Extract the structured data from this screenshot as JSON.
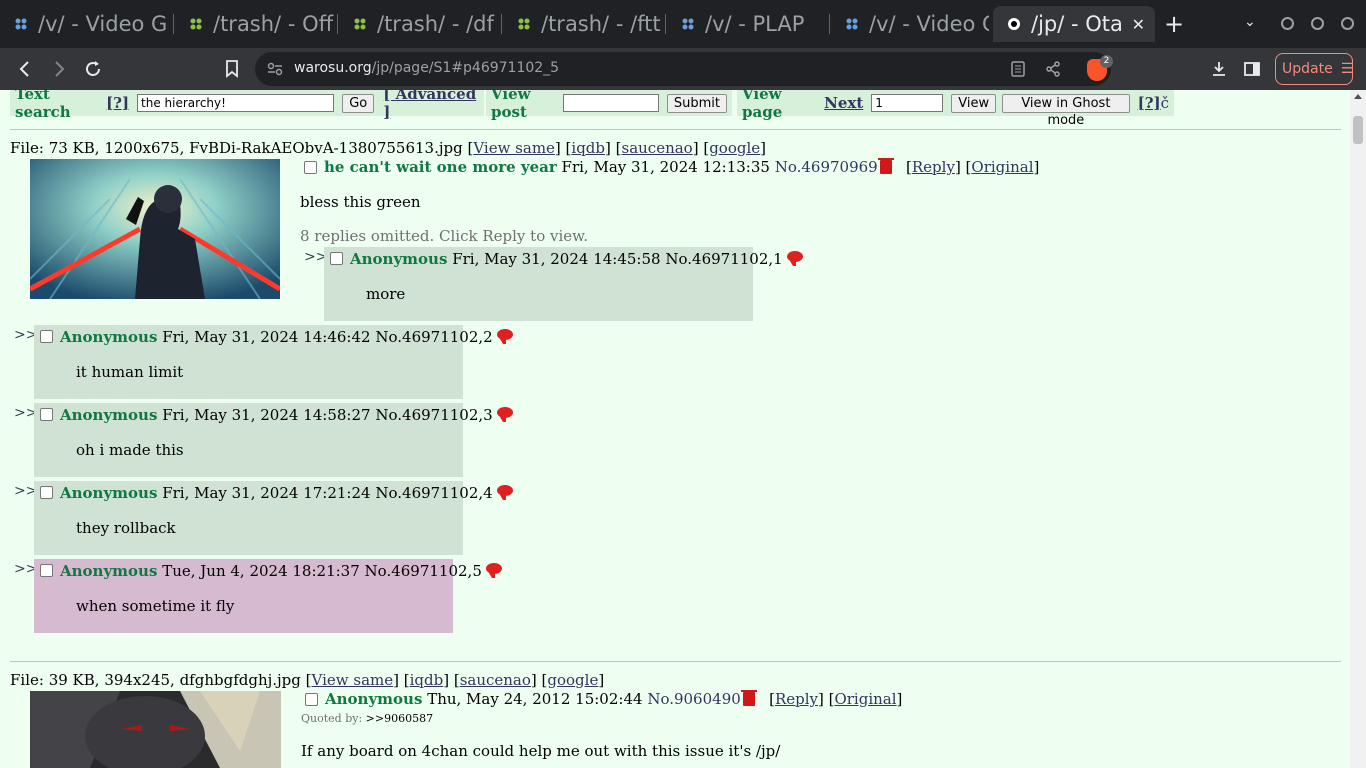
{
  "browser": {
    "tabs": [
      {
        "title": "/v/ - Video G"
      },
      {
        "title": "/trash/ - Off"
      },
      {
        "title": "/trash/ - /df"
      },
      {
        "title": "/trash/ - /ftt"
      },
      {
        "title": "/v/ - PLAP"
      },
      {
        "title": "/v/ - Video G"
      },
      {
        "title": "/jp/ - Ota"
      }
    ],
    "new_tab": "+",
    "url_host": "warosu.org",
    "url_path": "/jp/page/S1#p46971102_5",
    "shields_count": "2",
    "update_label": "Update"
  },
  "toolbar": {
    "text_search_label": "Text search",
    "help": "[?]",
    "search_value": "the hierarchy!",
    "go": "Go",
    "advanced": "[ Advanced ]",
    "view_post_label": "View post",
    "view_post_value": "",
    "submit": "Submit",
    "view_page_label": "View page",
    "next": "Next",
    "page_value": "1",
    "view": "View",
    "ghost": "View in Ghost mode",
    "help2": "[?]"
  },
  "threads": [
    {
      "file_prefix": "File: 73 KB, 1200x675, FvBDi-RakAEObvA-1380755613.jpg [",
      "view_same": "View same",
      "iqdb": "iqdb",
      "saucenao": "saucenao",
      "google": "google",
      "subject": "he can't wait one more year",
      "date": "Fri, May 31, 2024 12:13:35",
      "no": "No.46970969",
      "reply": "Reply",
      "original": "Original",
      "body": "bless this green",
      "omitted": "8 replies omitted. Click Reply to view."
    },
    {
      "file_prefix": "File: 39 KB, 394x245, dfghbgfdghj.jpg [",
      "view_same": "View same",
      "iqdb": "iqdb",
      "saucenao": "saucenao",
      "google": "google",
      "name": "Anonymous",
      "date": "Thu, May 24, 2012 15:02:44",
      "no": "No.9060490",
      "reply": "Reply",
      "original": "Original",
      "quoted_by_label": "Quoted by:",
      "quoted_by": ">>9060587",
      "body": "If any board on 4chan could help me out with this issue it's /jp/"
    }
  ],
  "replies": [
    {
      "arrows": ">>",
      "name": "Anonymous",
      "date": "Fri, May 31, 2024 14:45:58",
      "no": "No.46971102,1",
      "body": "more"
    },
    {
      "arrows": ">>",
      "name": "Anonymous",
      "date": "Fri, May 31, 2024 14:46:42",
      "no": "No.46971102,2",
      "body": "it human limit"
    },
    {
      "arrows": ">>",
      "name": "Anonymous",
      "date": "Fri, May 31, 2024 14:58:27",
      "no": "No.46971102,3",
      "body": "oh i made this"
    },
    {
      "arrows": ">>",
      "name": "Anonymous",
      "date": "Fri, May 31, 2024 17:21:24",
      "no": "No.46971102,4",
      "body": "they rollback"
    },
    {
      "arrows": ">>",
      "name": "Anonymous",
      "date": "Tue, Jun 4, 2024 18:21:37",
      "no": "No.46971102,5",
      "body": "when sometime it fly"
    }
  ],
  "colors": {
    "accent_green": "#117743",
    "link": "#34345c",
    "reply_bg": "#d0e2d4",
    "highlight_bg": "#d6bad0"
  }
}
